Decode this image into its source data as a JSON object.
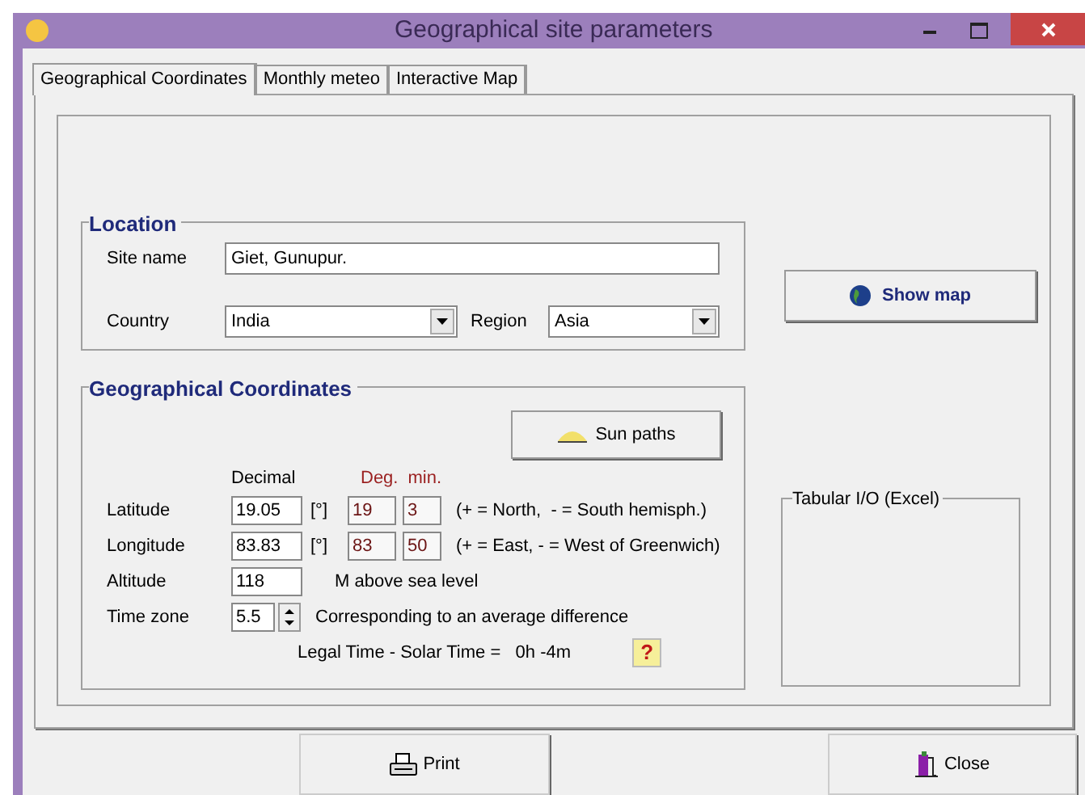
{
  "window": {
    "title": "Geographical site parameters"
  },
  "tabs": [
    {
      "label": "Geographical Coordinates",
      "selected": true
    },
    {
      "label": "Monthly meteo",
      "selected": false
    },
    {
      "label": "Interactive Map",
      "selected": false
    }
  ],
  "location": {
    "title": "Location",
    "site_name": {
      "label": "Site name",
      "value": "Giet, Gunupur."
    },
    "country": {
      "label": "Country",
      "value": "India"
    },
    "region": {
      "label": "Region",
      "value": "Asia"
    }
  },
  "show_map": "Show map",
  "coordinates": {
    "title": "Geographical Coordinates",
    "sun_paths": "Sun paths",
    "headers": {
      "decimal": "Decimal",
      "deg": "Deg.",
      "min": "min."
    },
    "rows": [
      {
        "label": "Latitude",
        "decimal": "19.05",
        "unit": "[°]",
        "deg": "19",
        "min": "3",
        "note": "(+ = North,  - = South hemisph.)"
      },
      {
        "label": "Longitude",
        "decimal": "83.83",
        "unit": "[°]",
        "deg": "83",
        "min": "50",
        "note": "(+ = East, - = West of Greenwich)"
      }
    ],
    "altitude": {
      "label": "Altitude",
      "value": "118",
      "note": "M above sea level"
    },
    "time_zone": {
      "label": "Time zone",
      "value": "5.5",
      "note": "Corresponding to an average difference"
    },
    "legal_time": {
      "label": "Legal Time - Solar Time =",
      "value": "0h -4m"
    },
    "help": "?"
  },
  "tabular": {
    "title": "Tabular I/O (Excel)"
  },
  "buttons": {
    "print": "Print",
    "close": "Close"
  }
}
